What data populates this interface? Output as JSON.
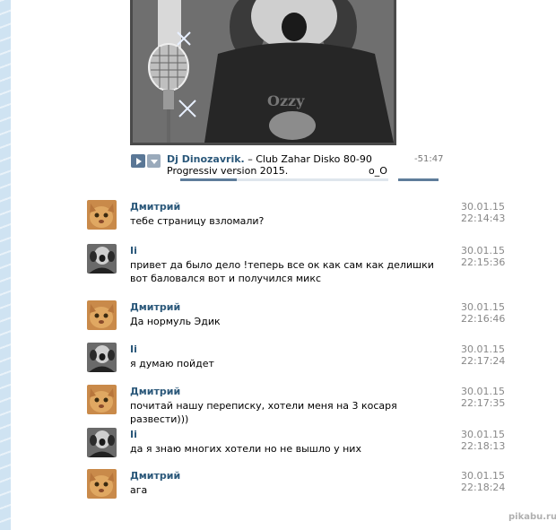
{
  "audio": {
    "artist": "Dj Dinozavrik.",
    "title": " – Club Zahar Disko 80-90 Progressiv version 2015.",
    "extra": "o_O",
    "duration": "-51:47",
    "progress_fraction": 0.27
  },
  "messages": [
    {
      "author": "Дмитрий",
      "avatar": "cat-avatar",
      "text": "тебе страницу взломали?",
      "date": "30.01.15",
      "time": "22:14:43"
    },
    {
      "author": "Ii",
      "avatar": "boy-avatar",
      "text": "привет да было дело !теперь все ок как сам как делишки вот баловался вот и получился микс",
      "date": "30.01.15",
      "time": "22:15:36"
    },
    {
      "author": "Дмитрий",
      "avatar": "cat-avatar",
      "text": "Да нормуль Эдик",
      "date": "30.01.15",
      "time": "22:16:46"
    },
    {
      "author": "Ii",
      "avatar": "boy-avatar",
      "text": "я думаю пойдет",
      "date": "30.01.15",
      "time": "22:17:24"
    },
    {
      "author": "Дмитрий",
      "avatar": "cat-avatar",
      "text": "почитай нашу переписку, хотели меня на 3 косаря развести)))",
      "date": "30.01.15",
      "time": "22:17:35"
    },
    {
      "author": "Ii",
      "avatar": "boy-avatar",
      "text": "да я знаю многих хотели но не вышло у них",
      "date": "30.01.15",
      "time": "22:18:13"
    },
    {
      "author": "Дмитрий",
      "avatar": "cat-avatar",
      "text": "ага",
      "date": "30.01.15",
      "time": "22:18:24"
    }
  ],
  "watermark": "pikabu.ru"
}
